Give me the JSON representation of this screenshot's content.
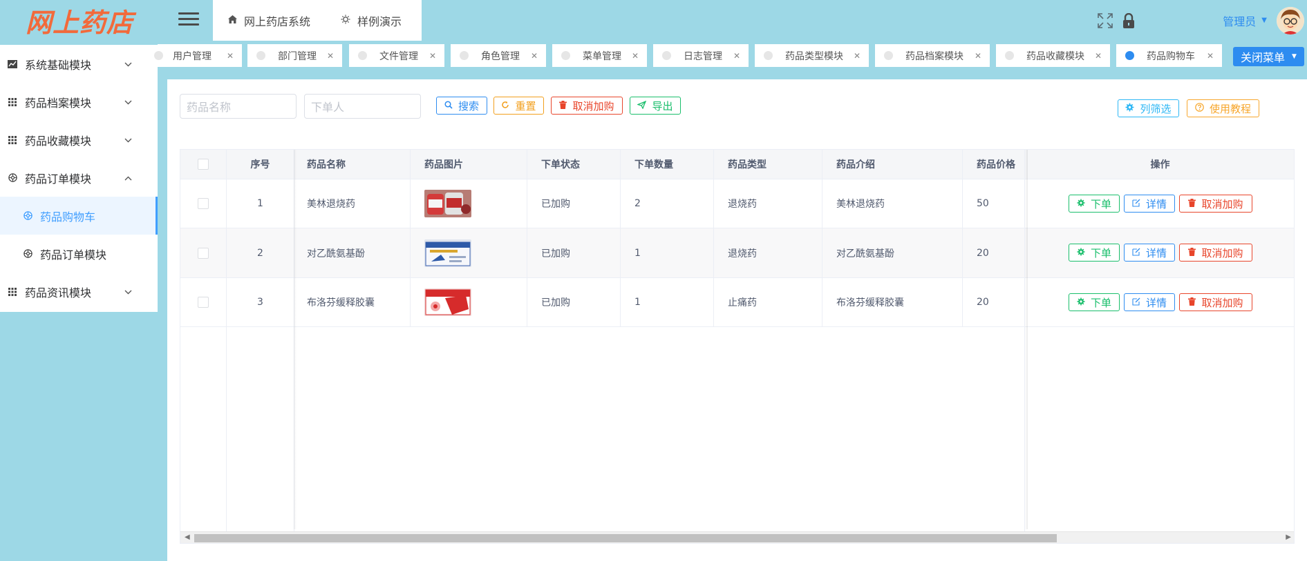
{
  "app": {
    "logo_text": "网上药店",
    "colors": {
      "accent": "#2d8cf0",
      "header_bg": "#9dd8e6",
      "logo": "#f26a3b",
      "danger": "#e8452b",
      "success": "#19be6b",
      "warning": "#f29f1d"
    }
  },
  "header": {
    "nav": [
      {
        "icon": "home-icon",
        "label": "网上药店系统"
      },
      {
        "icon": "lightbulb-icon",
        "label": "样例演示"
      }
    ],
    "user": {
      "label": "管理员"
    }
  },
  "sidebar": {
    "items": [
      {
        "icon": "chart-icon",
        "label": "系统基础模块",
        "expanded": false
      },
      {
        "icon": "grid-icon",
        "label": "药品档案模块",
        "expanded": false
      },
      {
        "icon": "grid-icon",
        "label": "药品收藏模块",
        "expanded": false
      },
      {
        "icon": "aperture-icon",
        "label": "药品订单模块",
        "expanded": true
      },
      {
        "icon": "aperture-icon",
        "label": "药品购物车",
        "sub": true,
        "active": true
      },
      {
        "icon": "aperture-icon",
        "label": "药品订单模块",
        "sub": true
      },
      {
        "icon": "grid-icon",
        "label": "药品资讯模块",
        "expanded": false
      }
    ]
  },
  "tabs": {
    "items": [
      "用户管理",
      "部门管理",
      "文件管理",
      "角色管理",
      "菜单管理",
      "日志管理",
      "药品类型模块",
      "药品档案模块",
      "药品收藏模块",
      "药品购物车"
    ],
    "active_index": 9,
    "close_menu_label": "关闭菜单"
  },
  "search": {
    "drug_name_placeholder": "药品名称",
    "orderer_placeholder": "下单人",
    "search_label": "搜索",
    "reset_label": "重置",
    "cancel_cart_label": "取消加购",
    "export_label": "导出",
    "column_filter_label": "列筛选",
    "tutorial_label": "使用教程"
  },
  "table": {
    "columns": [
      "序号",
      "药品名称",
      "药品图片",
      "下单状态",
      "下单数量",
      "药品类型",
      "药品介绍",
      "药品价格",
      "操作"
    ],
    "rows": [
      {
        "index": "1",
        "name": "美林退烧药",
        "status": "已加购",
        "qty": "2",
        "type": "退烧药",
        "intro": "美林退烧药",
        "price": "50"
      },
      {
        "index": "2",
        "name": "对乙酰氨基酚",
        "status": "已加购",
        "qty": "1",
        "type": "退烧药",
        "intro": "对乙酰氨基酚",
        "price": "20"
      },
      {
        "index": "3",
        "name": "布洛芬缓释胶囊",
        "status": "已加购",
        "qty": "1",
        "type": "止痛药",
        "intro": "布洛芬缓释胶囊",
        "price": "20"
      }
    ],
    "actions": {
      "order": "下单",
      "detail": "详情",
      "cancel": "取消加购"
    }
  }
}
